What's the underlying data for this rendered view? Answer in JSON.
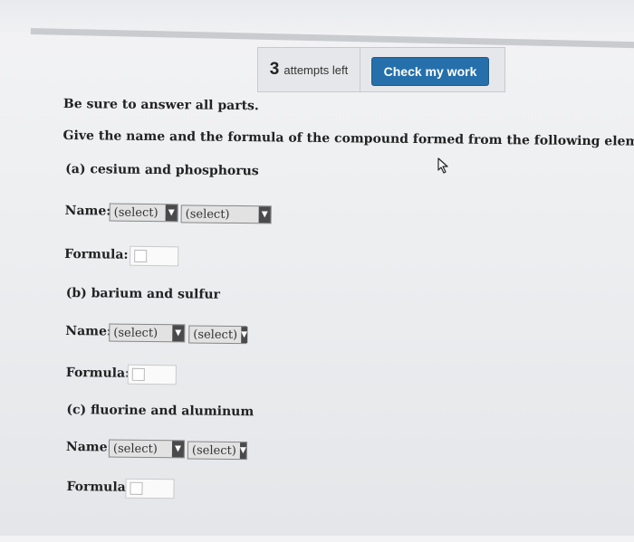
{
  "header": {
    "attempts_count": "3",
    "attempts_label": "attempts left",
    "check_button_label": "Check my work"
  },
  "question": {
    "instruction": "Be sure to answer all parts.",
    "prompt": "Give the name and the formula of the compound formed from the following elements:",
    "name_label": "Name:",
    "formula_label": "Formula:",
    "parts": [
      {
        "label": "(a) cesium and phosphorus",
        "select1": "(select)",
        "select2": "(select)"
      },
      {
        "label": "(b) barium and sulfur",
        "select1": "(select)",
        "select2": "(select)"
      },
      {
        "label": "(c) fluorine and aluminum",
        "select1": "(select)",
        "select2": "(select)"
      }
    ]
  },
  "colors": {
    "check_button": "#2570ab",
    "dropdown_arrow": "#4a4a4c"
  },
  "icons": {
    "dropdown": "triangle-down",
    "pointer": "mouse-cursor"
  }
}
